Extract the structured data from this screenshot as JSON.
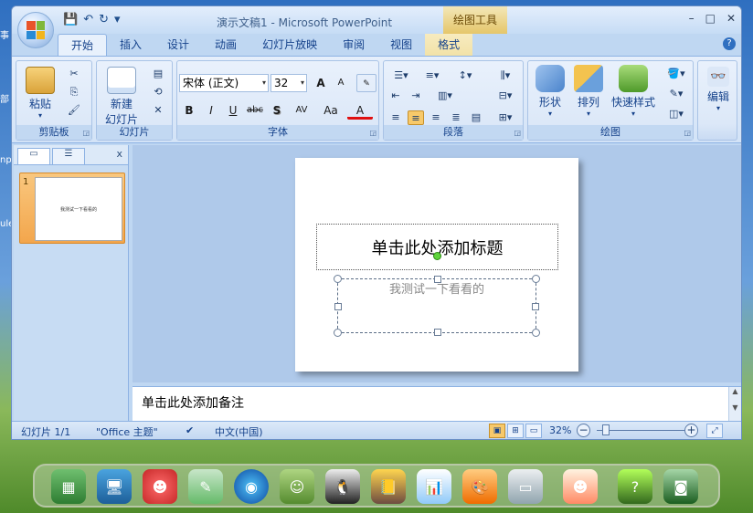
{
  "window": {
    "title": "演示文稿1 - Microsoft PowerPoint",
    "context_tab": "绘图工具",
    "controls": [
      "–",
      "□",
      "✕"
    ]
  },
  "qat": {
    "save_icon": "save-icon",
    "undo": "↶",
    "redo": "↻",
    "customize": "▾"
  },
  "tabs": [
    "开始",
    "插入",
    "设计",
    "动画",
    "幻灯片放映",
    "审阅",
    "视图",
    "格式"
  ],
  "active_tab": "开始",
  "ribbon": {
    "clipboard": {
      "label": "剪贴板",
      "paste": "粘贴"
    },
    "slides": {
      "label": "幻灯片",
      "new_slide": "新建",
      "new_slide2": "幻灯片"
    },
    "font": {
      "label": "字体",
      "font_name": "宋体 (正文)",
      "font_size": "32",
      "bold": "B",
      "italic": "I",
      "underline": "U",
      "strike": "abc",
      "shadow": "S",
      "spacing": "AV",
      "case": "Aa",
      "color": "A",
      "grow": "A",
      "shrink": "A"
    },
    "paragraph": {
      "label": "段落"
    },
    "drawing": {
      "label": "绘图",
      "shape": "形状",
      "arrange": "排列",
      "quick_styles": "快速样式"
    },
    "editing": {
      "label": "编辑"
    }
  },
  "left_pane": {
    "close": "x",
    "slide_number": "1",
    "thumb_text": "我测试一下看看的"
  },
  "slide": {
    "title_placeholder": "单击此处添加标题",
    "body_text": "我测试一下看看的"
  },
  "notes": {
    "placeholder": "单击此处添加备注"
  },
  "status": {
    "slide": "幻灯片 1/1",
    "theme": "\"Office 主题\"",
    "language": "中文(中国)",
    "zoom": "32%",
    "zoom_value": 0.32
  },
  "dock": {
    "icons": [
      "image-viewer-icon",
      "monitor-icon",
      "mascot-icon",
      "notes-icon",
      "media-player-icon",
      "chat-buddy-icon",
      "penguin-icon",
      "book-icon",
      "chart-app-icon",
      "paint-palette-icon",
      "usb-drive-icon",
      "cartoon-icon",
      "green-question-icon",
      "camera-icon"
    ]
  },
  "colors": {
    "accent": "#15428b",
    "selection": "#f3a64c",
    "ribbon": "#dce8f8"
  }
}
